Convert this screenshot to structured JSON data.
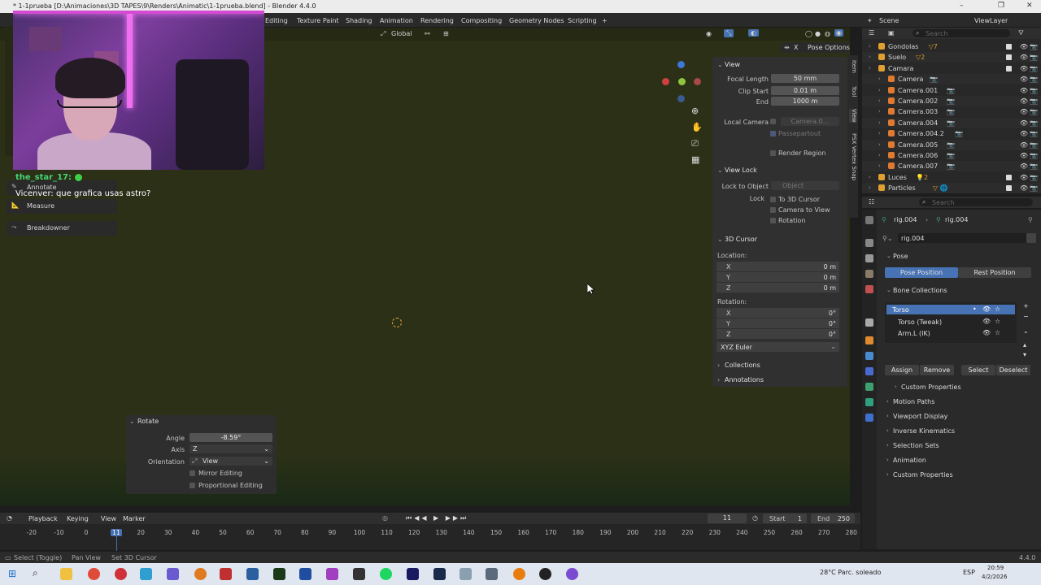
{
  "window": {
    "title": "* 1-1prueba [D:\\Animaciones\\3D TAPES\\9\\Renders\\Animatic\\1-1prueba.blend] - Blender 4.4.0",
    "controls": [
      "–",
      "❐",
      "✕"
    ]
  },
  "workspaces": [
    "Editing",
    "Texture Paint",
    "Shading",
    "Animation",
    "Rendering",
    "Compositing",
    "Geometry Nodes",
    "Scripting",
    "+"
  ],
  "topbar_right": {
    "scene": "Scene",
    "viewlayer": "ViewLayer"
  },
  "viewport_header": {
    "orientation": "Global",
    "pose_options": "Pose Options"
  },
  "chat": {
    "user": "the_star_17:",
    "sender": "Vicenver:",
    "message": "que grafica usas astro?"
  },
  "toolbar": [
    {
      "label": "Annotate",
      "icon": "✎"
    },
    {
      "label": "Measure",
      "icon": "📐"
    },
    {
      "label": "Breakdowner",
      "icon": "⤳"
    }
  ],
  "npanel": {
    "view_header": "View",
    "focal_length_label": "Focal Length",
    "focal_length": "50 mm",
    "clip_start_label": "Clip Start",
    "clip_start": "0.01 m",
    "end_label": "End",
    "end": "1000 m",
    "local_camera_label": "Local Camera",
    "local_camera_value": "Camera.0...",
    "passepartout": "Passepartout",
    "render_region": "Render Region",
    "view_lock_header": "View Lock",
    "lock_to_object_label": "Lock to Object",
    "lock_to_object_placeholder": "Object",
    "lock_label": "Lock",
    "to_3d_cursor": "To 3D Cursor",
    "camera_to_view": "Camera to View",
    "rotation_lock": "Rotation",
    "cursor_header": "3D Cursor",
    "location_label": "Location:",
    "location": [
      {
        "axis": "X",
        "value": "0 m"
      },
      {
        "axis": "Y",
        "value": "0 m"
      },
      {
        "axis": "Z",
        "value": "0 m"
      }
    ],
    "rotation_label": "Rotation:",
    "rotation": [
      {
        "axis": "X",
        "value": "0°"
      },
      {
        "axis": "Y",
        "value": "0°"
      },
      {
        "axis": "Z",
        "value": "0°"
      }
    ],
    "rotation_mode": "XYZ Euler",
    "collections": "Collections",
    "annotations": "Annotations",
    "tabs": [
      "Item",
      "Tool",
      "View",
      "PSX Vertex Snap"
    ]
  },
  "rotate_panel": {
    "header": "Rotate",
    "angle_label": "Angle",
    "angle": "-8.59°",
    "axis_label": "Axis",
    "axis": "Z",
    "orientation_label": "Orientation",
    "orientation": "View",
    "mirror": "Mirror Editing",
    "proportional": "Proportional Editing"
  },
  "timeline": {
    "menus": [
      "Playback",
      "Keying",
      "View",
      "Marker"
    ],
    "current_frame": "11",
    "start_label": "Start",
    "start": "1",
    "end_label": "End",
    "end": "250",
    "ticks": [
      "-20",
      "-10",
      "0",
      "11",
      "20",
      "30",
      "40",
      "50",
      "60",
      "70",
      "80",
      "90",
      "100",
      "110",
      "120",
      "130",
      "140",
      "150",
      "160",
      "170",
      "180",
      "190",
      "200",
      "210",
      "220",
      "230",
      "240",
      "250",
      "260",
      "270",
      "280"
    ]
  },
  "status": {
    "select": "Select (Toggle)",
    "pan": "Pan View",
    "cursor": "Set 3D Cursor",
    "version": "4.4.0"
  },
  "outliner": {
    "search_placeholder": "Search",
    "rows": [
      {
        "name": "Gondolas",
        "indent": 0,
        "icon": "#e0a030",
        "extra": "▽7",
        "checkbox": true
      },
      {
        "name": "Suelo",
        "indent": 0,
        "icon": "#e0a030",
        "extra": "▽2",
        "checkbox": true
      },
      {
        "name": "Camara",
        "indent": 0,
        "icon": "#e0a030",
        "extra": "",
        "checkbox": true
      },
      {
        "name": "Camera",
        "indent": 1,
        "icon": "#e07a30",
        "extra": "📷",
        "checkbox": false
      },
      {
        "name": "Camera.001",
        "indent": 1,
        "icon": "#e07a30",
        "extra": "📷",
        "checkbox": false
      },
      {
        "name": "Camera.002",
        "indent": 1,
        "icon": "#e07a30",
        "extra": "📷",
        "checkbox": false
      },
      {
        "name": "Camera.003",
        "indent": 1,
        "icon": "#e07a30",
        "extra": "📷",
        "checkbox": false
      },
      {
        "name": "Camera.004",
        "indent": 1,
        "icon": "#e07a30",
        "extra": "📷",
        "checkbox": false
      },
      {
        "name": "Camera.004.2",
        "indent": 1,
        "icon": "#e07a30",
        "extra": "📷",
        "checkbox": false
      },
      {
        "name": "Camera.005",
        "indent": 1,
        "icon": "#e07a30",
        "extra": "📷",
        "checkbox": false
      },
      {
        "name": "Camera.006",
        "indent": 1,
        "icon": "#e07a30",
        "extra": "📷",
        "checkbox": false
      },
      {
        "name": "Camera.007",
        "indent": 1,
        "icon": "#e07a30",
        "extra": "📷",
        "checkbox": false
      },
      {
        "name": "Luces",
        "indent": 0,
        "icon": "#e0a030",
        "extra": "💡2",
        "checkbox": true
      },
      {
        "name": "Particles",
        "indent": 0,
        "icon": "#e0a030",
        "extra": "▽ 🌐",
        "checkbox": true
      }
    ]
  },
  "properties": {
    "search_placeholder": "Search",
    "breadcrumb": [
      "rig.004",
      "rig.004"
    ],
    "object_name": "rig.004",
    "pose_header": "Pose",
    "pose_position": "Pose Position",
    "rest_position": "Rest Position",
    "bone_collections_header": "Bone Collections",
    "bone_collections": [
      "Torso",
      "Torso (Tweak)",
      "Arm.L (IK)"
    ],
    "assign": "Assign",
    "remove": "Remove",
    "select": "Select",
    "deselect": "Deselect",
    "sections": [
      "Custom Properties",
      "Motion Paths",
      "Viewport Display",
      "Inverse Kinematics",
      "Selection Sets",
      "Animation",
      "Custom Properties"
    ]
  },
  "taskbar": {
    "weather": "28°C  Parc. soleado",
    "lang": "ESP",
    "time": "20:59",
    "date": "4/2/2026"
  },
  "colors": {
    "accent": "#4772b3",
    "viewport_bg": "#2b3016",
    "panel_bg": "#303030"
  }
}
